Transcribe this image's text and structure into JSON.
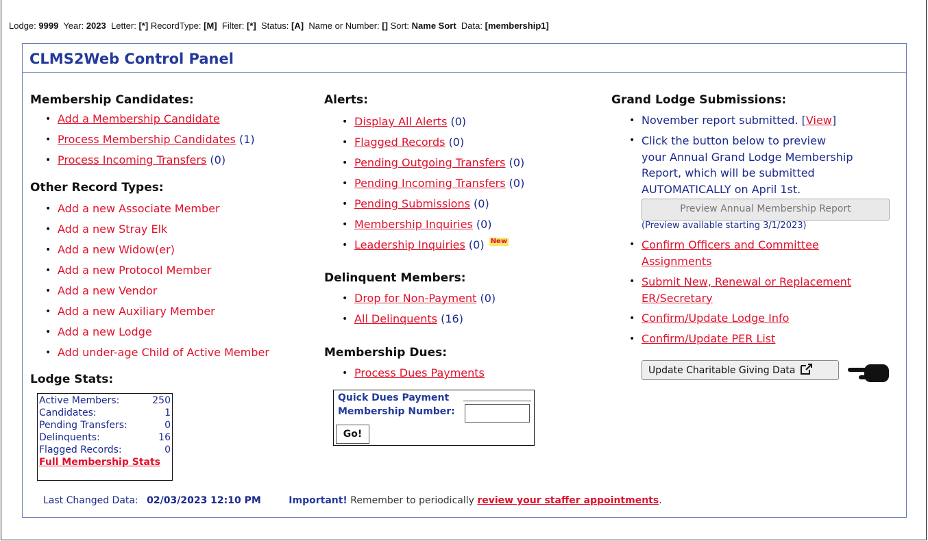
{
  "status_line": {
    "lodge_label": "Lodge:",
    "lodge_value": "9999",
    "year_label": "Year:",
    "year_value": "2023",
    "letter_label": "Letter:",
    "letter_value": "[*]",
    "recordtype_label": "RecordType:",
    "recordtype_value": "[M]",
    "filter_label": "Filter:",
    "filter_value": "[*]",
    "status_label": "Status:",
    "status_value": "[A]",
    "name_label": "Name or Number:",
    "name_value": "[]",
    "sort_label": "Sort:",
    "sort_value": "Name Sort",
    "data_label": "Data:",
    "data_value": "[membership1]"
  },
  "panel_title": "CLMS2Web Control Panel",
  "membership_candidates": {
    "heading": "Membership Candidates:",
    "items": [
      {
        "label": "Add a Membership Candidate",
        "count": ""
      },
      {
        "label": "Process Membership Candidates",
        "count": "(1)"
      },
      {
        "label": "Process Incoming Transfers",
        "count": "(0)"
      }
    ]
  },
  "other_record_types": {
    "heading": "Other Record Types:",
    "items": [
      "Add a new Associate Member",
      "Add a new Stray Elk",
      "Add a new Widow(er)",
      "Add a new Protocol Member",
      "Add a new Vendor",
      "Add a new Auxiliary Member",
      "Add a new Lodge",
      "Add under-age Child of Active Member"
    ]
  },
  "lodge_stats": {
    "heading": "Lodge Stats:",
    "rows": [
      {
        "label": "Active Members:",
        "value": "250"
      },
      {
        "label": "Candidates:",
        "value": "1"
      },
      {
        "label": "Pending Transfers:",
        "value": "0"
      },
      {
        "label": "Delinquents:",
        "value": "16"
      },
      {
        "label": "Flagged Records:",
        "value": "0"
      }
    ],
    "full_link": "Full Membership Stats"
  },
  "alerts": {
    "heading": "Alerts:",
    "items": [
      {
        "label": "Display All Alerts",
        "count": "(0)"
      },
      {
        "label": "Flagged Records",
        "count": "(0)"
      },
      {
        "label": "Pending Outgoing Transfers",
        "count": "(0)"
      },
      {
        "label": "Pending Incoming Transfers",
        "count": "(0)"
      },
      {
        "label": "Pending Submissions",
        "count": "(0)"
      },
      {
        "label": "Membership Inquiries",
        "count": "(0)"
      },
      {
        "label": "Leadership Inquiries",
        "count": "(0)",
        "badge": "New"
      }
    ]
  },
  "delinquent_members": {
    "heading": "Delinquent Members:",
    "items": [
      {
        "label": "Drop for Non-Payment",
        "count": "(0)"
      },
      {
        "label": "All Delinquents",
        "count": "(16)"
      }
    ]
  },
  "membership_dues": {
    "heading": "Membership Dues:",
    "item": "Process Dues Payments",
    "quick_title": "Quick Dues Payment",
    "quick_number_label": "Membership Number:",
    "quick_number_value": "",
    "go_label": "Go!"
  },
  "grand_lodge": {
    "heading": "Grand Lodge Submissions:",
    "report_text": "November report submitted.",
    "view_open": "[",
    "view_label": "View",
    "view_close": "]",
    "preview_text_lines": [
      "Click the button below to preview",
      "your Annual Grand Lodge Membership",
      "Report, which will be submitted",
      "AUTOMATICALLY on April 1st."
    ],
    "preview_button": "Preview Annual Membership Report",
    "preview_note": "(Preview available starting 3/1/2023)",
    "links": [
      [
        "Confirm Officers and Committee",
        "Assignments"
      ],
      [
        "Submit New, Renewal or Replacement",
        "ER/Secretary"
      ],
      [
        "Confirm/Update Lodge Info"
      ],
      [
        "Confirm/Update PER List"
      ]
    ],
    "charitable_button": "Update Charitable Giving Data"
  },
  "footer": {
    "last_changed_label": "Last Changed Data:",
    "last_changed_value": "02/03/2023  12:10 PM",
    "important_label": "Important!",
    "remember_text": "Remember to periodically",
    "review_link": "review your staffer appointments",
    "period": "."
  },
  "colors": {
    "link": "#e0112b",
    "text": "#1a2a8c",
    "title": "#233a9a"
  },
  "icons": [
    "external-link-icon",
    "pointing-hand-icon"
  ]
}
